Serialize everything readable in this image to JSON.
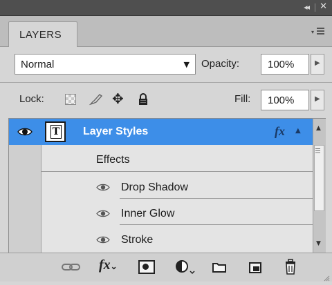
{
  "window": {
    "collapse_glyph": "◂◂",
    "close_glyph": "✕"
  },
  "panel": {
    "tab_label": "LAYERS",
    "menu_icon": "panel-menu-icon"
  },
  "blend": {
    "mode": "Normal",
    "opacity_label": "Opacity:",
    "opacity_value": "100%"
  },
  "lock": {
    "label": "Lock:",
    "fill_label": "Fill:",
    "fill_value": "100%"
  },
  "layers": [
    {
      "name": "Layer Styles",
      "type_glyph": "T",
      "fx_label": "fx",
      "selected": true,
      "visible": true,
      "effects_label": "Effects",
      "effects": [
        {
          "name": "Drop Shadow"
        },
        {
          "name": "Inner Glow"
        },
        {
          "name": "Stroke"
        }
      ]
    }
  ],
  "toolbar": {
    "fx_label": "fx",
    "icons": [
      "link-layers-icon",
      "layer-style-icon",
      "add-mask-icon",
      "adjustment-layer-icon",
      "new-group-icon",
      "new-layer-icon",
      "delete-layer-icon"
    ]
  },
  "colors": {
    "selection": "#3d8ee8",
    "panel_bg": "#d6d6d6",
    "titlebar": "#4f4f4f"
  }
}
